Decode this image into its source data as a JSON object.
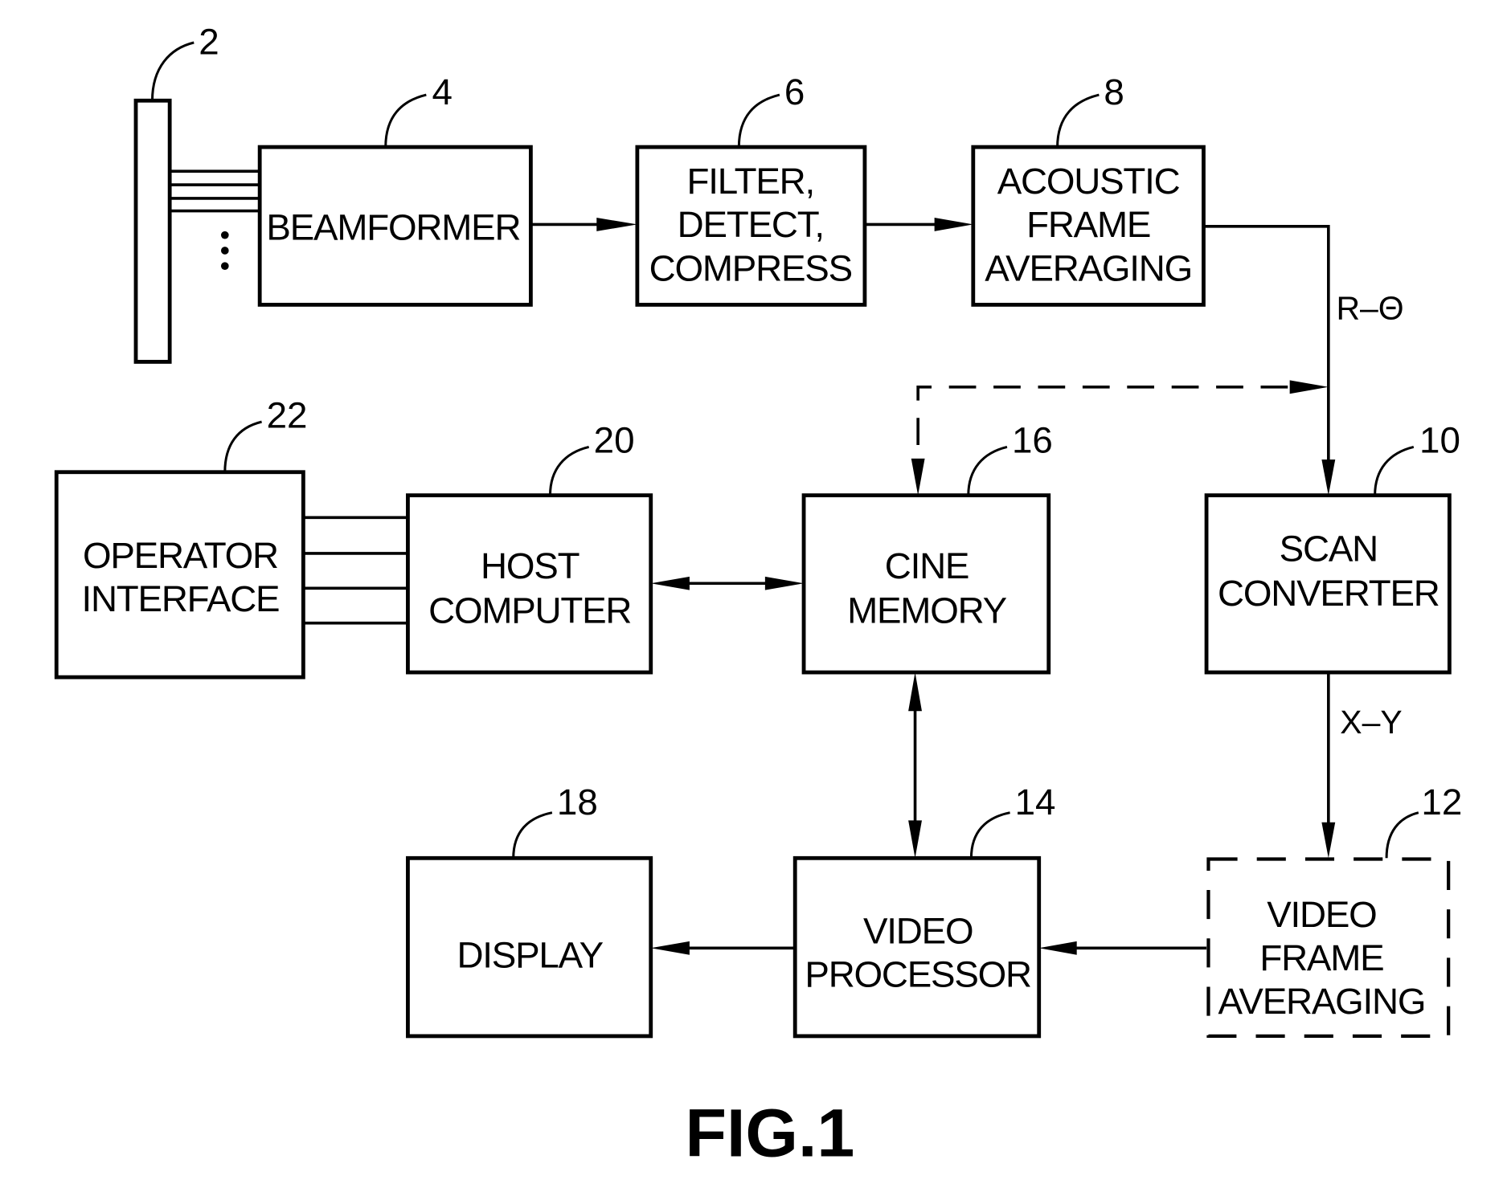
{
  "figure": {
    "caption": "FIG.1",
    "ink_color": "#000000",
    "background_color": "#ffffff"
  },
  "blocks": {
    "transducer": {
      "ref": "2",
      "lines": []
    },
    "beamformer": {
      "ref": "4",
      "lines": [
        "BEAMFORMER"
      ]
    },
    "filter": {
      "ref": "6",
      "lines": [
        "FILTER,",
        "DETECT,",
        "COMPRESS"
      ]
    },
    "acoustic": {
      "ref": "8",
      "lines": [
        "ACOUSTIC",
        "FRAME",
        "AVERAGING"
      ]
    },
    "scan_converter": {
      "ref": "10",
      "lines": [
        "SCAN",
        "CONVERTER"
      ]
    },
    "video_frame_avg": {
      "ref": "12",
      "lines": [
        "VIDEO",
        "FRAME",
        "AVERAGING"
      ],
      "optional": true
    },
    "video_processor": {
      "ref": "14",
      "lines": [
        "VIDEO",
        "PROCESSOR"
      ]
    },
    "cine_memory": {
      "ref": "16",
      "lines": [
        "CINE",
        "MEMORY"
      ]
    },
    "display": {
      "ref": "18",
      "lines": [
        "DISPLAY"
      ]
    },
    "host_computer": {
      "ref": "20",
      "lines": [
        "HOST",
        "COMPUTER"
      ]
    },
    "operator_interface": {
      "ref": "22",
      "lines": [
        "OPERATOR",
        "INTERFACE"
      ]
    }
  },
  "signals": {
    "r_theta": "R–Θ",
    "x_y": "X–Y"
  },
  "connections": [
    {
      "from": "transducer",
      "to": "beamformer",
      "kind": "multi-line bus"
    },
    {
      "from": "beamformer",
      "to": "filter",
      "kind": "arrow"
    },
    {
      "from": "filter",
      "to": "acoustic",
      "kind": "arrow"
    },
    {
      "from": "acoustic",
      "to": "scan_converter",
      "kind": "arrow",
      "label": "R–Θ"
    },
    {
      "from": "r_theta_path",
      "to": "cine_memory",
      "kind": "dashed bidirectional"
    },
    {
      "from": "scan_converter",
      "to": "video_frame_avg",
      "kind": "arrow",
      "label": "X–Y"
    },
    {
      "from": "video_frame_avg",
      "to": "video_processor",
      "kind": "arrow"
    },
    {
      "from": "video_processor",
      "to": "display",
      "kind": "arrow"
    },
    {
      "from": "cine_memory",
      "to": "video_processor",
      "kind": "bidirectional arrow"
    },
    {
      "from": "host_computer",
      "to": "cine_memory",
      "kind": "bidirectional arrow"
    },
    {
      "from": "operator_interface",
      "to": "host_computer",
      "kind": "multi-line bus"
    }
  ]
}
